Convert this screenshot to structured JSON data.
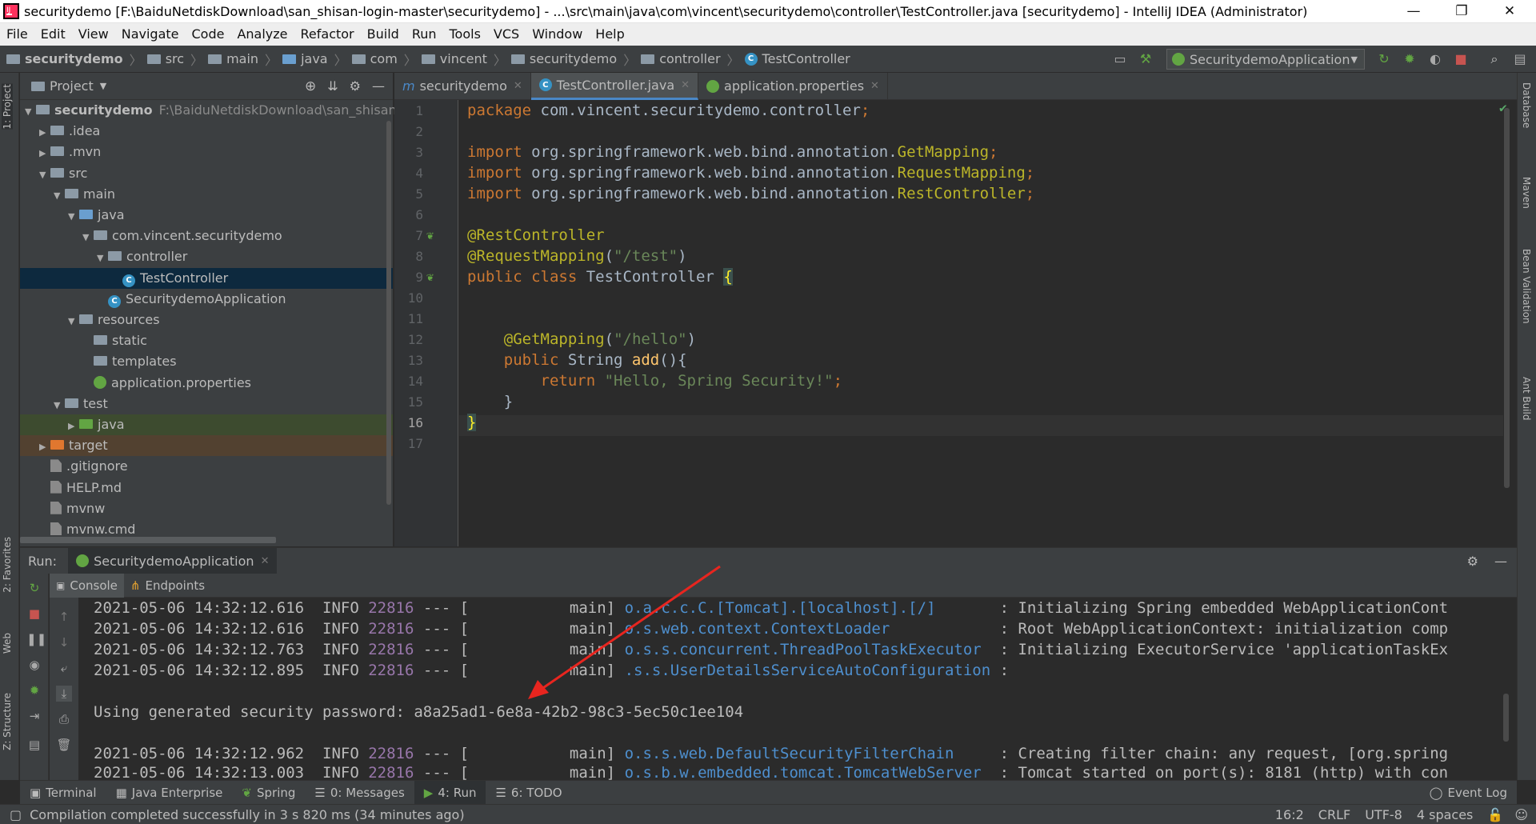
{
  "window": {
    "title": "securitydemo [F:\\BaiduNetdiskDownload\\san_shisan-login-master\\securitydemo] - ...\\src\\main\\java\\com\\vincent\\securitydemo\\controller\\TestController.java [securitydemo] - IntelliJ IDEA (Administrator)",
    "minimize": "—",
    "restore": "❐",
    "close": "✕"
  },
  "menu": [
    "File",
    "Edit",
    "View",
    "Navigate",
    "Code",
    "Analyze",
    "Refactor",
    "Build",
    "Run",
    "Tools",
    "VCS",
    "Window",
    "Help"
  ],
  "breadcrumb": [
    "securitydemo",
    "src",
    "main",
    "java",
    "com",
    "vincent",
    "securitydemo",
    "controller",
    "TestController"
  ],
  "run_config": "SecuritydemoApplication",
  "left_stripe": {
    "project": "1: Project",
    "favorites": "2: Favorites",
    "web": "Web",
    "structure": "Z: Structure"
  },
  "right_stripe": {
    "database": "Database",
    "maven": "Maven",
    "bean": "Bean Validation",
    "ant": "Ant Build"
  },
  "project": {
    "header": "Project",
    "tree": [
      {
        "label": "securitydemo",
        "path": "F:\\BaiduNetdiskDownload\\san_shisan-login",
        "depth": 0,
        "arrow": "▼",
        "icon": "folder"
      },
      {
        "label": ".idea",
        "depth": 1,
        "arrow": "▶",
        "icon": "folder"
      },
      {
        "label": ".mvn",
        "depth": 1,
        "arrow": "▶",
        "icon": "folder"
      },
      {
        "label": "src",
        "depth": 1,
        "arrow": "▼",
        "icon": "folder"
      },
      {
        "label": "main",
        "depth": 2,
        "arrow": "▼",
        "icon": "folder"
      },
      {
        "label": "java",
        "depth": 3,
        "arrow": "▼",
        "icon": "folder-blue"
      },
      {
        "label": "com.vincent.securitydemo",
        "depth": 4,
        "arrow": "▼",
        "icon": "package"
      },
      {
        "label": "controller",
        "depth": 5,
        "arrow": "▼",
        "icon": "package"
      },
      {
        "label": "TestController",
        "depth": 6,
        "arrow": "",
        "icon": "class"
      },
      {
        "label": "SecuritydemoApplication",
        "depth": 5,
        "arrow": "",
        "icon": "class"
      },
      {
        "label": "resources",
        "depth": 3,
        "arrow": "▼",
        "icon": "folder"
      },
      {
        "label": "static",
        "depth": 4,
        "arrow": "",
        "icon": "folder"
      },
      {
        "label": "templates",
        "depth": 4,
        "arrow": "",
        "icon": "folder"
      },
      {
        "label": "application.properties",
        "depth": 4,
        "arrow": "",
        "icon": "properties"
      },
      {
        "label": "test",
        "depth": 2,
        "arrow": "▼",
        "icon": "folder"
      },
      {
        "label": "java",
        "depth": 3,
        "arrow": "▶",
        "icon": "folder-green"
      },
      {
        "label": "target",
        "depth": 1,
        "arrow": "▶",
        "icon": "folder-orange"
      },
      {
        "label": ".gitignore",
        "depth": 1,
        "arrow": "",
        "icon": "file"
      },
      {
        "label": "HELP.md",
        "depth": 1,
        "arrow": "",
        "icon": "file"
      },
      {
        "label": "mvnw",
        "depth": 1,
        "arrow": "",
        "icon": "file"
      },
      {
        "label": "mvnw.cmd",
        "depth": 1,
        "arrow": "",
        "icon": "file"
      }
    ]
  },
  "editor": {
    "tabs": [
      {
        "label": "securitydemo",
        "prefix": "m"
      },
      {
        "label": "TestController.java",
        "prefix": "C"
      },
      {
        "label": "application.properties",
        "prefix": ""
      }
    ],
    "line_numbers": [
      "1",
      "2",
      "3",
      "4",
      "5",
      "6",
      "7",
      "8",
      "9",
      "10",
      "11",
      "12",
      "13",
      "14",
      "15",
      "16",
      "17"
    ]
  },
  "run": {
    "label": "Run:",
    "tab": "SecuritydemoApplication",
    "console_tab": "Console",
    "endpoints_tab": "Endpoints",
    "logs": [
      {
        "ts": "2021-05-06 14:32:12.616",
        "level": "INFO",
        "pid": "22816",
        "sep": "--- [",
        "thread": "main]",
        "logger": "o.a.c.c.C.[Tomcat].[localhost].[/]",
        "msg": ": Initializing Spring embedded WebApplicationCont"
      },
      {
        "ts": "2021-05-06 14:32:12.616",
        "level": "INFO",
        "pid": "22816",
        "sep": "--- [",
        "thread": "main]",
        "logger": "o.s.web.context.ContextLoader",
        "msg": ": Root WebApplicationContext: initialization comp"
      },
      {
        "ts": "2021-05-06 14:32:12.763",
        "level": "INFO",
        "pid": "22816",
        "sep": "--- [",
        "thread": "main]",
        "logger": "o.s.s.concurrent.ThreadPoolTaskExecutor",
        "msg": ": Initializing ExecutorService 'applicationTaskEx"
      },
      {
        "ts": "2021-05-06 14:32:12.895",
        "level": "INFO",
        "pid": "22816",
        "sep": "--- [",
        "thread": "main]",
        "logger": ".s.s.UserDetailsServiceAutoConfiguration",
        "msg": ":"
      }
    ],
    "password_line": "Using generated security password: a8a25ad1-6e8a-42b2-98c3-5ec50c1ee104",
    "logs2": [
      {
        "ts": "2021-05-06 14:32:12.962",
        "level": "INFO",
        "pid": "22816",
        "sep": "--- [",
        "thread": "main]",
        "logger": "o.s.s.web.DefaultSecurityFilterChain",
        "msg": ": Creating filter chain: any request, [org.spring"
      },
      {
        "ts": "2021-05-06 14:32:13.003",
        "level": "INFO",
        "pid": "22816",
        "sep": "--- [",
        "thread": "main]",
        "logger": "o.s.b.w.embedded.tomcat.TomcatWebServer",
        "msg": ": Tomcat started on port(s): 8181 (http) with con"
      }
    ]
  },
  "bottom_tabs": [
    "Terminal",
    "Java Enterprise",
    "Spring",
    "0: Messages",
    "4: Run",
    "6: TODO"
  ],
  "event_log": "Event Log",
  "status": {
    "message": "Compilation completed successfully in 3 s 820 ms (34 minutes ago)",
    "position": "16:2",
    "line_sep": "CRLF",
    "encoding": "UTF-8",
    "indent": "4 spaces"
  }
}
